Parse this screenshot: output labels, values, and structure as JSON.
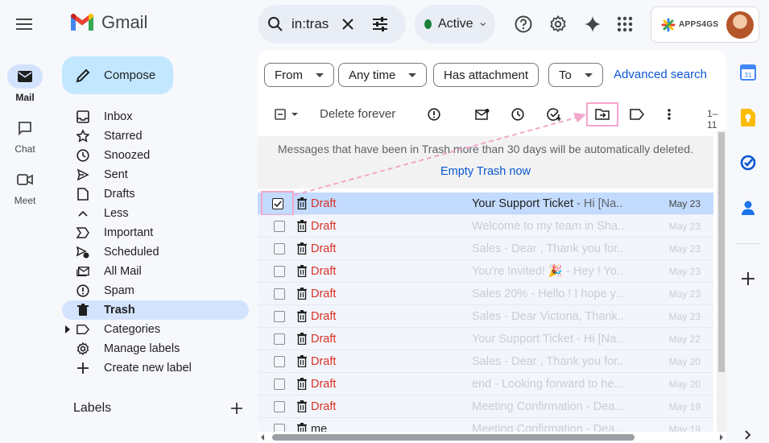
{
  "app": {
    "name": "Gmail"
  },
  "search": {
    "value": "in:tras"
  },
  "status": {
    "label": "Active",
    "color": "#188038"
  },
  "account": {
    "org": "APPS4GS"
  },
  "rail": [
    {
      "label": "Mail",
      "icon": "mail-icon",
      "active": true
    },
    {
      "label": "Chat",
      "icon": "chat-icon"
    },
    {
      "label": "Meet",
      "icon": "meet-icon"
    }
  ],
  "compose": {
    "label": "Compose"
  },
  "nav": [
    {
      "label": "Inbox",
      "icon": "inbox-icon"
    },
    {
      "label": "Starred",
      "icon": "star-icon"
    },
    {
      "label": "Snoozed",
      "icon": "clock-icon"
    },
    {
      "label": "Sent",
      "icon": "send-icon"
    },
    {
      "label": "Drafts",
      "icon": "draft-icon"
    },
    {
      "label": "Less",
      "icon": "chevron-up-icon"
    },
    {
      "label": "Important",
      "icon": "important-icon"
    },
    {
      "label": "Scheduled",
      "icon": "scheduled-icon"
    },
    {
      "label": "All Mail",
      "icon": "all-mail-icon"
    },
    {
      "label": "Spam",
      "icon": "spam-icon"
    },
    {
      "label": "Trash",
      "icon": "trash-icon",
      "active": true
    },
    {
      "label": "Categories",
      "icon": "label-icon"
    },
    {
      "label": "Manage labels",
      "icon": "gear-icon"
    },
    {
      "label": "Create new label",
      "icon": "plus-icon"
    }
  ],
  "labels": {
    "title": "Labels"
  },
  "filters": {
    "from": "From",
    "any_time": "Any time",
    "has_attachment": "Has attachment",
    "to": "To",
    "advanced": "Advanced search"
  },
  "toolbar": {
    "delete_forever": "Delete forever",
    "pager": "1–11"
  },
  "banner": {
    "text": "Messages that have been in Trash more than 30 days will be automatically deleted.",
    "action": "Empty Trash now"
  },
  "emails": [
    {
      "sender": "Draft",
      "subject": "Your Support Ticket",
      "snippet": " - Hi [Na...",
      "date": "May 23",
      "selected": true
    },
    {
      "sender": "Draft",
      "subject": "Welcome to my team in Sha...",
      "snippet": "",
      "date": "May 23"
    },
    {
      "sender": "Draft",
      "subject": "Sales",
      "snippet": " - Dear , Thank you for...",
      "date": "May 23"
    },
    {
      "sender": "Draft",
      "subject": "You're Invited! 🎉",
      "snippet": " - Hey ! Yo...",
      "date": "May 23"
    },
    {
      "sender": "Draft",
      "subject": "Sales 20%",
      "snippet": " - Hello ! I hope y...",
      "date": "May 23"
    },
    {
      "sender": "Draft",
      "subject": "Sales",
      "snippet": " - Dear Victoria, Thank...",
      "date": "May 23"
    },
    {
      "sender": "Draft",
      "subject": "Your Support Ticket",
      "snippet": " - Hi [Na...",
      "date": "May 22"
    },
    {
      "sender": "Draft",
      "subject": "Sales",
      "snippet": " - Dear , Thank you for...",
      "date": "May 20"
    },
    {
      "sender": "Draft",
      "subject": "end",
      "snippet": " - Looking forward to he...",
      "date": "May 20"
    },
    {
      "sender": "Draft",
      "subject": "Meeting Confirmation",
      "snippet": " - Dea...",
      "date": "May 19"
    },
    {
      "sender": "me",
      "subject": "Meeting Confirmation",
      "snippet": " - Dea...",
      "date": "May 19"
    }
  ],
  "colors": {
    "accent": "#0b57d0",
    "compose": "#c2e7ff",
    "selected_row": "#c2dbff",
    "highlight": "#f4a6cb",
    "draft": "#d93025"
  }
}
